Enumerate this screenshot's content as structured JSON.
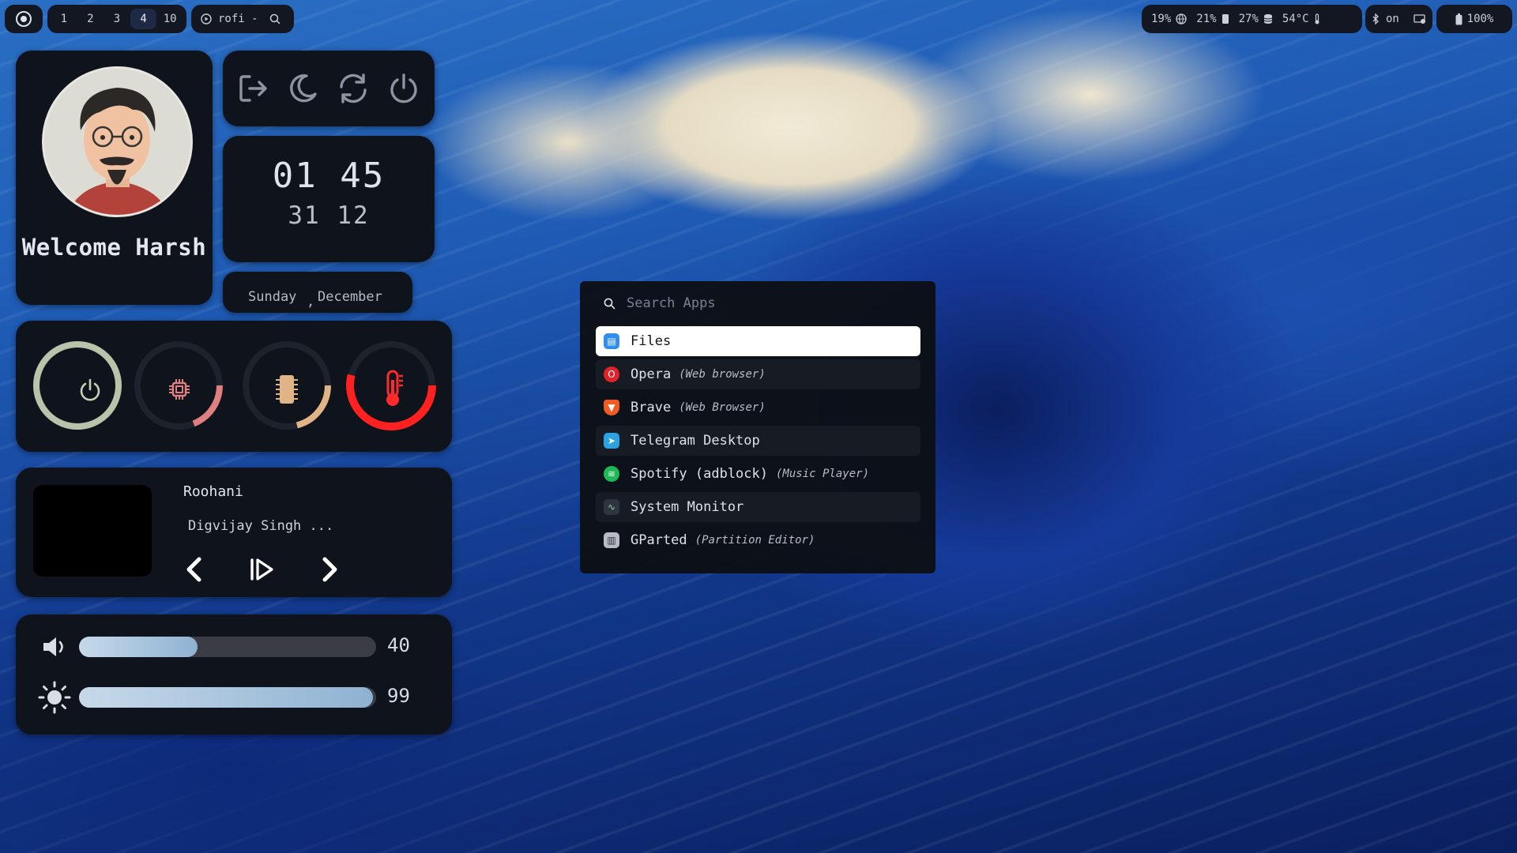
{
  "topbar": {
    "workspaces": [
      "1",
      "2",
      "3",
      "4",
      "10"
    ],
    "active_workspace": "4",
    "window_title": "rofi -",
    "stats": {
      "cpu": "19%",
      "memory": "21%",
      "disk": "27%",
      "temperature": "54°C",
      "bluetooth": "on",
      "battery": "100%"
    }
  },
  "profile": {
    "welcome": "Welcome Harsh"
  },
  "clock": {
    "time": "01 45",
    "date": "31 12",
    "day": "Sunday",
    "comma": ",",
    "month": "December"
  },
  "gauges": [
    {
      "name": "power",
      "color": "#b9c3a9",
      "level": 1.0
    },
    {
      "name": "cpu",
      "color": "#e07f7f",
      "level": 0.19
    },
    {
      "name": "memory",
      "color": "#e1b487",
      "level": 0.21
    },
    {
      "name": "temperature",
      "color": "#ff2020",
      "level": 0.54
    }
  ],
  "media": {
    "title": "Roohani",
    "artist": "Digvijay Singh ..."
  },
  "sliders": {
    "volume": {
      "value": "40",
      "level": 0.4
    },
    "brightness": {
      "value": "99",
      "level": 0.99
    }
  },
  "launcher": {
    "placeholder": "Search Apps",
    "items": [
      {
        "name": "Files",
        "generic": "",
        "icon": "files-icon"
      },
      {
        "name": "Opera",
        "generic": "(Web browser)",
        "icon": "opera-icon"
      },
      {
        "name": "Brave",
        "generic": "(Web Browser)",
        "icon": "brave-icon"
      },
      {
        "name": "Telegram Desktop",
        "generic": "",
        "icon": "telegram-icon"
      },
      {
        "name": "Spotify (adblock)",
        "generic": "(Music Player)",
        "icon": "spotify-icon"
      },
      {
        "name": "System Monitor",
        "generic": "",
        "icon": "system-monitor-icon"
      },
      {
        "name": "GParted",
        "generic": "(Partition Editor)",
        "icon": "gparted-icon"
      }
    ]
  }
}
